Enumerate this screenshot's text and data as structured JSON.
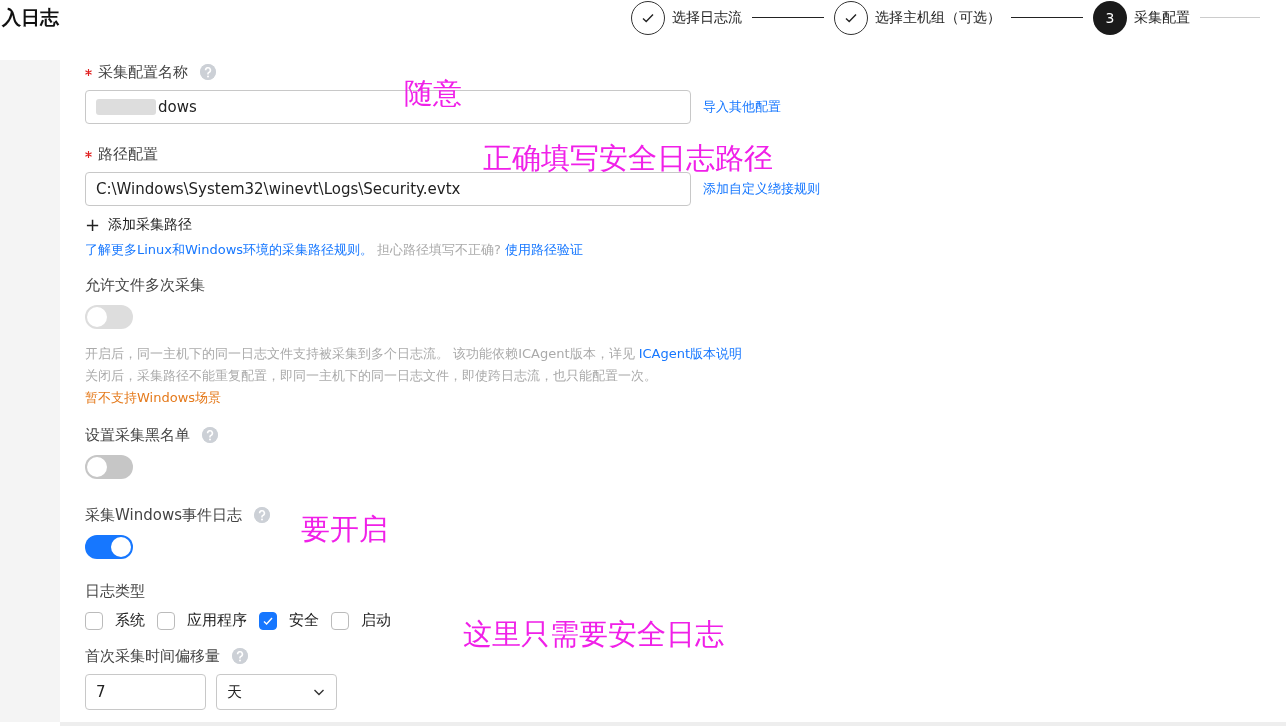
{
  "page_title": "入日志",
  "steps": [
    {
      "label": "选择日志流",
      "done": true
    },
    {
      "label": "选择主机组（可选）",
      "done": true
    },
    {
      "number": "3",
      "label": "采集配置",
      "done": false
    }
  ],
  "name_field": {
    "label": "采集配置名称",
    "required": true,
    "value": "dows",
    "link": "导入其他配置"
  },
  "path_field": {
    "label": "路径配置",
    "required": true,
    "value": "C:\\Windows\\System32\\winevt\\Logs\\Security.evtx",
    "link": "添加自定义绕接规则"
  },
  "add_path": {
    "icon": "+",
    "label": "添加采集路径"
  },
  "path_help": {
    "link": "了解更多Linux和Windows环境的采集路径规则。",
    "text": "担心路径填写不正确?",
    "action": "使用路径验证"
  },
  "multi_collect": {
    "label": "允许文件多次采集",
    "on": false,
    "help_1": "开启后，同一主机下的同一日志文件支持被采集到多个日志流。 该功能依赖ICAgent版本，详见",
    "help_link": "ICAgent版本说明",
    "help_2": "关闭后，采集路径不能重复配置，即同一主机下的同一日志文件，即使跨日志流，也只能配置一次。",
    "warning": "暂不支持Windows场景"
  },
  "blacklist": {
    "label": "设置采集黑名单",
    "on": false
  },
  "windows_events": {
    "label": "采集Windows事件日志",
    "on": true
  },
  "log_types": {
    "label": "日志类型",
    "options": [
      {
        "label": "系统",
        "checked": false
      },
      {
        "label": "应用程序",
        "checked": false
      },
      {
        "label": "安全",
        "checked": true
      },
      {
        "label": "启动",
        "checked": false
      }
    ]
  },
  "offset": {
    "label": "首次采集时间偏移量",
    "value": "7",
    "unit": "天"
  },
  "annotations": [
    "随意",
    "正确填写安全日志路径",
    "要开启",
    "这里只需要安全日志"
  ]
}
